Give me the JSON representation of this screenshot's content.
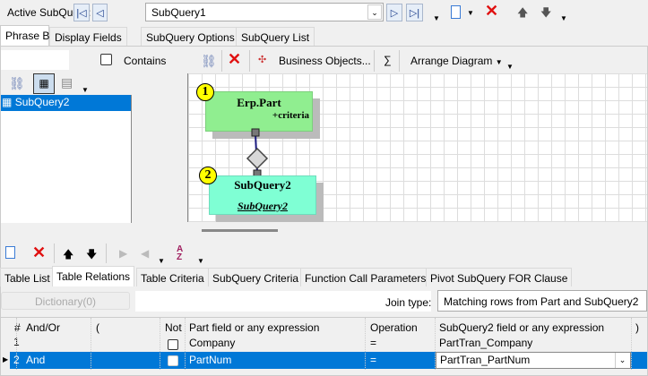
{
  "top": {
    "label": "Active SubQuery:",
    "current": "SubQuery1"
  },
  "tabs": [
    "Phrase Build",
    "Display Fields",
    "SubQuery Options",
    "SubQuery List"
  ],
  "left": {
    "search_value": "",
    "contains_label": "Contains",
    "items": [
      "SubQuery2"
    ]
  },
  "diagram_toolbar": {
    "business_objects": "Business Objects...",
    "sigma": "∑",
    "arrange": "Arrange Diagram"
  },
  "diagram": {
    "nodes": [
      {
        "badge": "1",
        "title": "Erp.Part",
        "subtitle": "+criteria",
        "color": "#90ee90"
      },
      {
        "badge": "2",
        "title": "SubQuery2",
        "subtitle": "SubQuery2",
        "color": "#7fffd4"
      }
    ]
  },
  "bottom_tabs": [
    "Table List",
    "Table Relations",
    "Table Criteria",
    "SubQuery Criteria",
    "Function Call Parameters",
    "Pivot SubQuery FOR Clause"
  ],
  "relations": {
    "dictionary": "Dictionary(0)",
    "join_label": "Join type:",
    "join_value": "Matching rows from Part and SubQuery2",
    "columns": [
      "#",
      "And/Or",
      "(",
      "Not",
      "Part field or any expression",
      "Operation",
      "SubQuery2 field or any expression",
      ")"
    ],
    "rows": [
      {
        "n": "1",
        "andor": "",
        "open": "",
        "not": false,
        "part": "Company",
        "op": "=",
        "sub": "PartTran_Company",
        "close": ""
      },
      {
        "n": "2",
        "andor": "And",
        "open": "",
        "not": false,
        "part": "PartNum",
        "op": "=",
        "sub": "PartTran_PartNum",
        "close": ""
      }
    ]
  }
}
